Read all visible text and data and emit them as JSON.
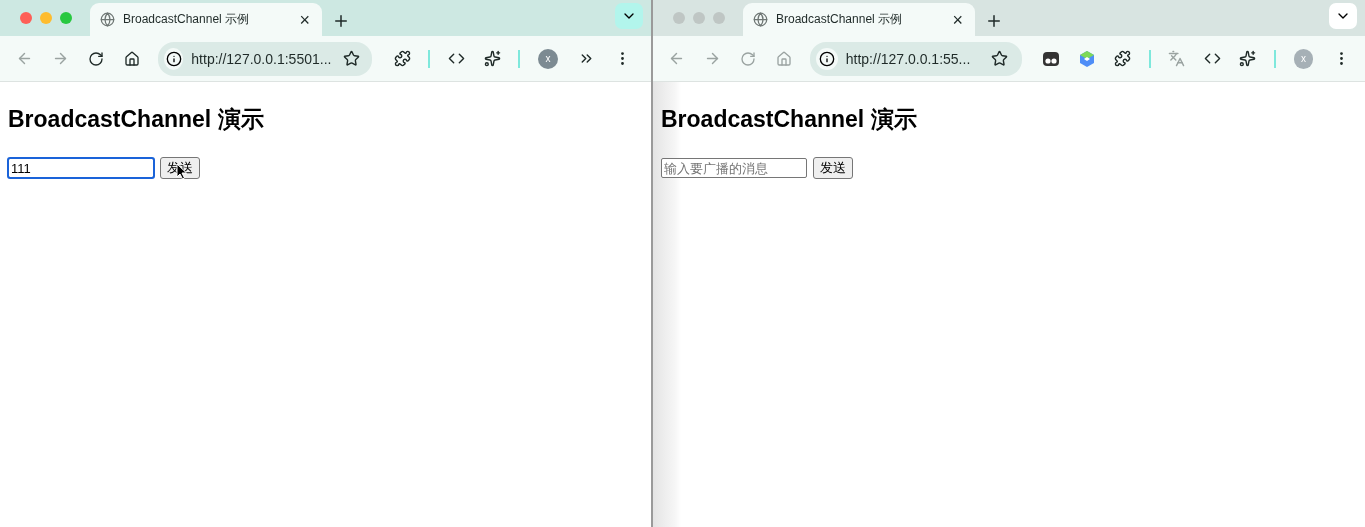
{
  "windows": [
    {
      "focused": true,
      "tab": {
        "title": "BroadcastChannel 示例",
        "close": "×"
      },
      "url": "http://127.0.0.1:5501...",
      "toolbar": [
        {
          "kind": "extension"
        },
        {
          "kind": "divider"
        },
        {
          "kind": "code"
        },
        {
          "kind": "favorites"
        },
        {
          "kind": "divider"
        },
        {
          "kind": "avatar",
          "label": "x"
        },
        {
          "kind": "overflow"
        },
        {
          "kind": "menu"
        }
      ],
      "page": {
        "heading": "BroadcastChannel 演示",
        "input": {
          "value": "111",
          "focused": true
        },
        "button": {
          "label": "发送",
          "pointer": true
        }
      }
    },
    {
      "focused": false,
      "tab": {
        "title": "BroadcastChannel 示例",
        "close": "×"
      },
      "url": "http://127.0.0.1:55...",
      "toolbar": [
        {
          "kind": "app"
        },
        {
          "kind": "logo"
        },
        {
          "kind": "extension"
        },
        {
          "kind": "divider"
        },
        {
          "kind": "translate"
        },
        {
          "kind": "code"
        },
        {
          "kind": "favorites"
        },
        {
          "kind": "divider"
        },
        {
          "kind": "avatar",
          "label": "x"
        },
        {
          "kind": "menu"
        }
      ],
      "page": {
        "heading": "BroadcastChannel 演示",
        "input": {
          "placeholder": "输入要广播的消息",
          "focused": false
        },
        "button": {
          "label": "发送",
          "pointer": false
        }
      }
    }
  ]
}
